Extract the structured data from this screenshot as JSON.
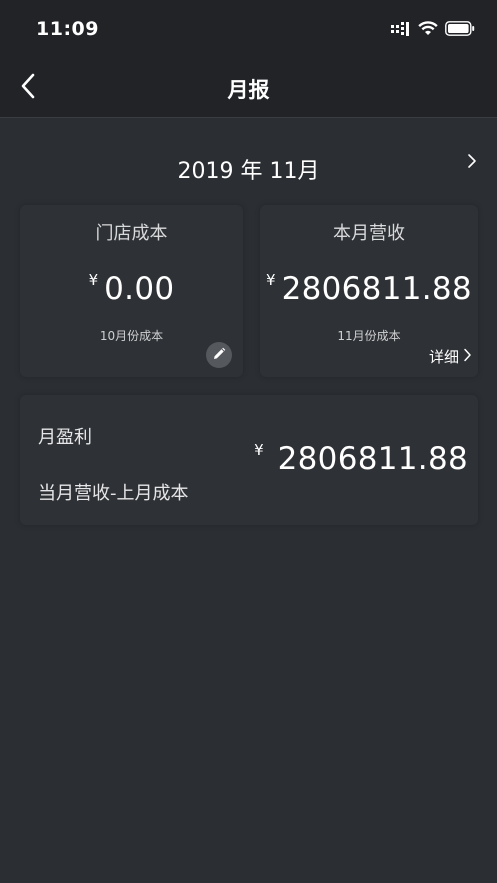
{
  "status_bar": {
    "time": "11:09",
    "icons": [
      "signal-icon",
      "wifi-icon",
      "battery-icon"
    ]
  },
  "nav": {
    "title": "月报",
    "back_icon": "chevron-left-icon"
  },
  "month_selector": {
    "label": "2019 年 11月",
    "next_icon": "chevron-right-icon"
  },
  "cost_card": {
    "title": "门店成本",
    "currency": "¥",
    "amount": "0.00",
    "subtitle": "10月份成本",
    "edit_icon": "pencil-icon"
  },
  "revenue_card": {
    "title": "本月营收",
    "currency": "¥",
    "amount": "2806811.88",
    "subtitle": "11月份成本",
    "detail_label": "详细"
  },
  "profit_card": {
    "title": "月盈利",
    "formula": "当月营收-上月成本",
    "currency": "¥",
    "amount": "2806811.88"
  },
  "colors": {
    "background": "#2b2e32",
    "header": "#212327",
    "card": "#2e3135",
    "text": "#ffffff"
  }
}
